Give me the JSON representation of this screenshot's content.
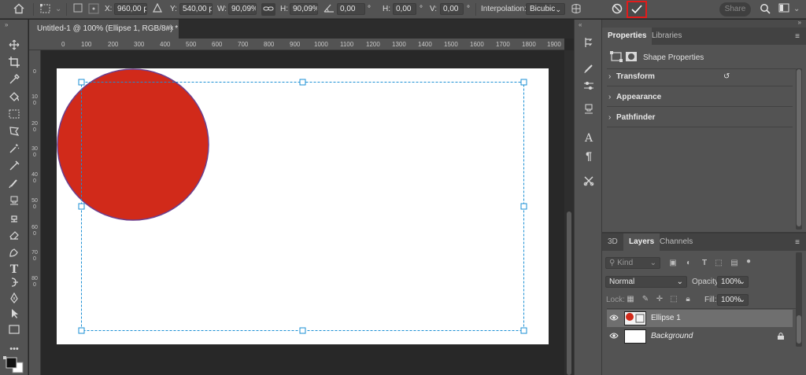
{
  "options_bar": {
    "x_label": "X:",
    "x_value": "960,00 px",
    "y_label": "Y:",
    "y_value": "540,00 px",
    "w_label": "W:",
    "w_value": "90,09%",
    "h_label": "H:",
    "h_value": "90,09%",
    "angle_value": "0,00",
    "angle_unit": "°",
    "hskew_label": "H:",
    "hskew_value": "0,00",
    "hskew_unit": "°",
    "vskew_label": "V:",
    "vskew_value": "0,00",
    "vskew_unit": "°",
    "interpolation_label": "Interpolation:",
    "interpolation_value": "Bicubic",
    "share_label": "Share",
    "commit_highlight": "#e21b1b"
  },
  "document": {
    "tab_title": "Untitled-1 @ 100% (Ellipse 1, RGB/8#) *",
    "close_glyph": "×",
    "ruler_h_ticks": [
      "0",
      "100",
      "200",
      "300",
      "400",
      "500",
      "600",
      "700",
      "800",
      "900",
      "1000",
      "1100",
      "1200",
      "1300",
      "1400",
      "1500",
      "1600",
      "1700",
      "1800",
      "1900"
    ],
    "ruler_v_ticks": [
      "0",
      "100",
      "200",
      "300",
      "400",
      "500",
      "600",
      "700",
      "800"
    ],
    "ellipse_fill": "#d12a1a",
    "ellipse_stroke": "#6b3f8f",
    "selection_color": "#1a8fd4"
  },
  "properties_panel": {
    "tabs": [
      "Properties",
      "Libraries"
    ],
    "header": "Shape Properties",
    "sections": [
      "Transform",
      "Appearance",
      "Pathfinder"
    ]
  },
  "layers_panel": {
    "tabs": [
      "3D",
      "Layers",
      "Channels"
    ],
    "kind_placeholder": "Kind",
    "blend_mode": "Normal",
    "opacity_label": "Opacity:",
    "opacity_value": "100%",
    "lock_label": "Lock:",
    "fill_label": "Fill:",
    "fill_value": "100%",
    "layers": [
      {
        "name": "Ellipse 1",
        "selected": true
      },
      {
        "name": "Background",
        "selected": false
      }
    ]
  }
}
